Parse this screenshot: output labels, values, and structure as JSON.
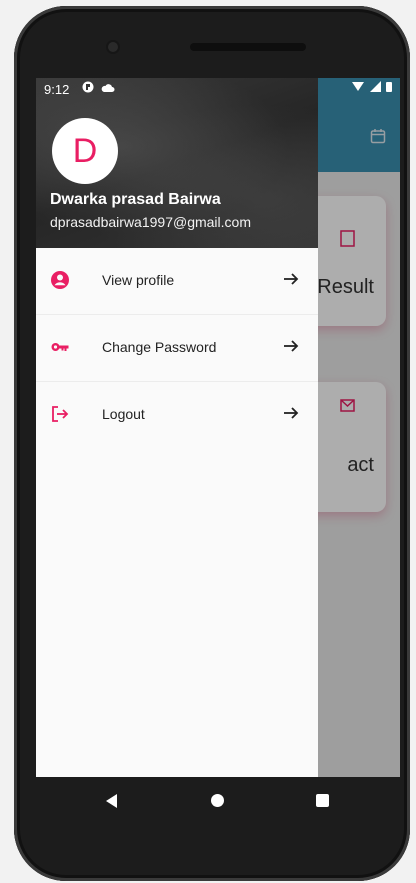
{
  "status_bar": {
    "time": "9:12"
  },
  "background_app": {
    "card_result_label": "Result",
    "card_contact_label": "act"
  },
  "drawer": {
    "avatar_letter": "D",
    "user_name": "Dwarka prasad Bairwa",
    "user_email": "dprasadbairwa1997@gmail.com",
    "items": [
      {
        "label": "View profile",
        "icon": "account-circle-icon"
      },
      {
        "label": "Change Password",
        "icon": "key-icon"
      },
      {
        "label": "Logout",
        "icon": "logout-icon"
      }
    ]
  },
  "colors": {
    "accent": "#e91e63",
    "appbar": "#3a8fb0"
  }
}
